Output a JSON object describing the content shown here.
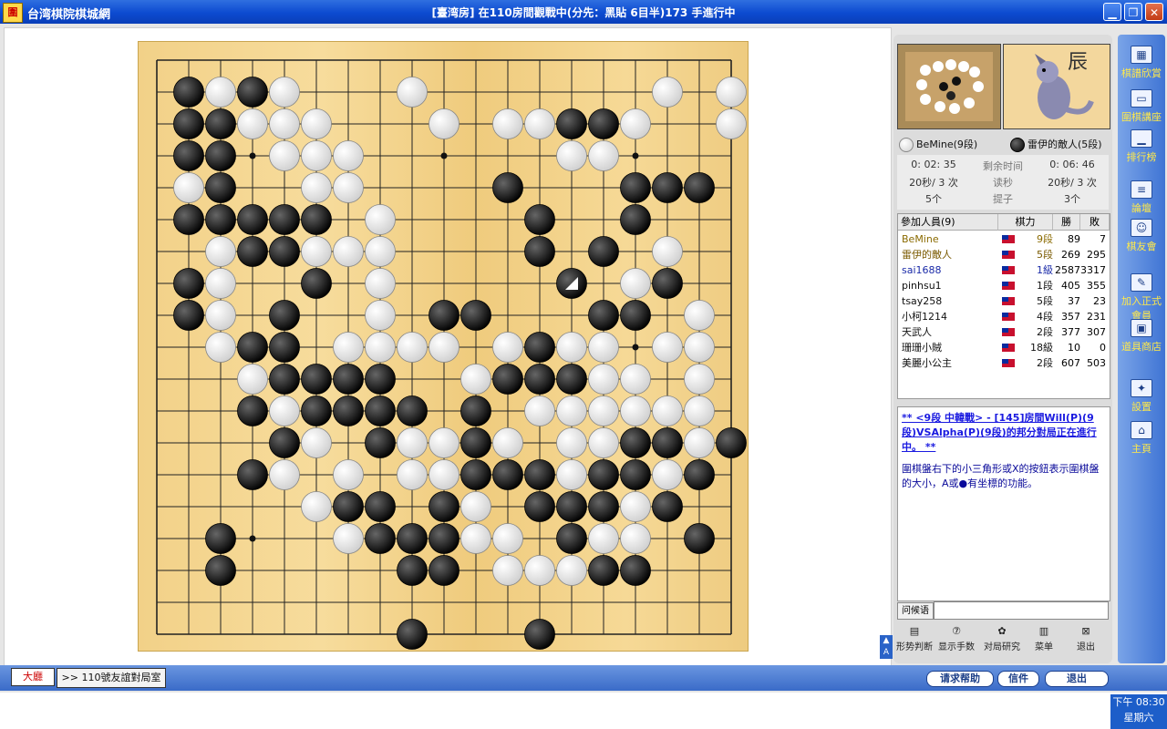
{
  "titlebar": {
    "app_icon": "圍",
    "app_title": "台湾棋院棋城網",
    "room_title": "[臺湾房] 在110房間觀戰中(分先：黑貼 6目半)173 手進行中",
    "minimize_glyph": "▁",
    "maximize_glyph": "❐",
    "close_glyph": "✕"
  },
  "board": {
    "size": 19,
    "white": [
      [
        3,
        2
      ],
      [
        4,
        2
      ],
      [
        5,
        3
      ],
      [
        3,
        3
      ],
      [
        4,
        3
      ],
      [
        5,
        4
      ],
      [
        6,
        4
      ],
      [
        7,
        5
      ],
      [
        9,
        2
      ],
      [
        10,
        3
      ],
      [
        12,
        3
      ],
      [
        13,
        3
      ],
      [
        14,
        4
      ],
      [
        15,
        4
      ],
      [
        16,
        3
      ],
      [
        17,
        2
      ],
      [
        19,
        2
      ],
      [
        19,
        3
      ],
      [
        16,
        5
      ],
      [
        16,
        6
      ],
      [
        17,
        7
      ],
      [
        16,
        8
      ],
      [
        17,
        8
      ],
      [
        18,
        9
      ],
      [
        15,
        10
      ],
      [
        17,
        10
      ],
      [
        18,
        10
      ],
      [
        18,
        11
      ],
      [
        18,
        12
      ],
      [
        18,
        13
      ],
      [
        17,
        14
      ],
      [
        16,
        15
      ],
      [
        16,
        16
      ],
      [
        15,
        16
      ],
      [
        15,
        17
      ],
      [
        13,
        17
      ],
      [
        14,
        17
      ],
      [
        12,
        17
      ],
      [
        10,
        17
      ],
      [
        11,
        16
      ],
      [
        13,
        15
      ],
      [
        12,
        14
      ],
      [
        12,
        13
      ],
      [
        11,
        13
      ],
      [
        11,
        12
      ],
      [
        11,
        11
      ],
      [
        10,
        10
      ],
      [
        9,
        10
      ],
      [
        8,
        10
      ],
      [
        7,
        10
      ],
      [
        8,
        9
      ],
      [
        8,
        8
      ],
      [
        8,
        7
      ],
      [
        8,
        6
      ],
      [
        7,
        7
      ],
      [
        6,
        7
      ],
      [
        6,
        6
      ],
      [
        6,
        5
      ],
      [
        7,
        4
      ],
      [
        6,
        3
      ],
      [
        5,
        2
      ],
      [
        2,
        5
      ],
      [
        2,
        4
      ],
      [
        3,
        7
      ],
      [
        3,
        8
      ],
      [
        3,
        9
      ],
      [
        3,
        10
      ],
      [
        4,
        11
      ],
      [
        5,
        12
      ],
      [
        6,
        13
      ],
      [
        6,
        15
      ],
      [
        5,
        14
      ],
      [
        7,
        14
      ],
      [
        7,
        16
      ],
      [
        10,
        15
      ],
      [
        10,
        14
      ],
      [
        9,
        14
      ],
      [
        9,
        13
      ],
      [
        13,
        12
      ],
      [
        12,
        11
      ],
      [
        12,
        10
      ],
      [
        13,
        10
      ],
      [
        14,
        10
      ],
      [
        14,
        11
      ],
      [
        14,
        12
      ],
      [
        15,
        12
      ],
      [
        16,
        12
      ],
      [
        17,
        12
      ],
      [
        12,
        16
      ],
      [
        11,
        15
      ],
      [
        10,
        13
      ],
      [
        15,
        11
      ],
      [
        16,
        11
      ],
      [
        14,
        13
      ],
      [
        15,
        13
      ],
      [
        14,
        14
      ],
      [
        4,
        14
      ]
    ],
    "black": [
      [
        2,
        3
      ],
      [
        2,
        4
      ],
      [
        3,
        4
      ],
      [
        4,
        6
      ],
      [
        5,
        6
      ],
      [
        5,
        7
      ],
      [
        6,
        8
      ],
      [
        6,
        6
      ],
      [
        4,
        7
      ],
      [
        3,
        6
      ],
      [
        3,
        5
      ],
      [
        3,
        3
      ],
      [
        2,
        2
      ],
      [
        4,
        2
      ],
      [
        2,
        6
      ],
      [
        2,
        8
      ],
      [
        2,
        9
      ],
      [
        4,
        10
      ],
      [
        5,
        9
      ],
      [
        5,
        10
      ],
      [
        5,
        11
      ],
      [
        4,
        12
      ],
      [
        5,
        13
      ],
      [
        4,
        14
      ],
      [
        3,
        16
      ],
      [
        3,
        17
      ],
      [
        6,
        12
      ],
      [
        6,
        11
      ],
      [
        7,
        11
      ],
      [
        7,
        12
      ],
      [
        8,
        12
      ],
      [
        8,
        13
      ],
      [
        7,
        15
      ],
      [
        8,
        15
      ],
      [
        8,
        16
      ],
      [
        9,
        16
      ],
      [
        9,
        17
      ],
      [
        10,
        16
      ],
      [
        10,
        17
      ],
      [
        9,
        19
      ],
      [
        11,
        13
      ],
      [
        11,
        14
      ],
      [
        12,
        14
      ],
      [
        13,
        14
      ],
      [
        13,
        15
      ],
      [
        14,
        15
      ],
      [
        14,
        16
      ],
      [
        15,
        14
      ],
      [
        15,
        15
      ],
      [
        16,
        14
      ],
      [
        16,
        13
      ],
      [
        17,
        13
      ],
      [
        18,
        14
      ],
      [
        18,
        16
      ],
      [
        17,
        15
      ],
      [
        15,
        17
      ],
      [
        16,
        17
      ],
      [
        13,
        19
      ],
      [
        10,
        15
      ],
      [
        11,
        12
      ],
      [
        13,
        10
      ],
      [
        14,
        8
      ],
      [
        15,
        7
      ],
      [
        16,
        6
      ],
      [
        16,
        5
      ],
      [
        17,
        5
      ],
      [
        18,
        5
      ],
      [
        19,
        13
      ],
      [
        15,
        9
      ],
      [
        14,
        11
      ],
      [
        13,
        11
      ],
      [
        12,
        11
      ],
      [
        11,
        9
      ],
      [
        10,
        9
      ],
      [
        9,
        12
      ],
      [
        8,
        11
      ],
      [
        16,
        9
      ],
      [
        17,
        8
      ],
      [
        14,
        3
      ],
      [
        12,
        5
      ],
      [
        13,
        6
      ],
      [
        13,
        7
      ],
      [
        15,
        3
      ]
    ],
    "last_move": [
      14,
      8
    ],
    "hoshi": [
      [
        4,
        4
      ],
      [
        10,
        4
      ],
      [
        16,
        4
      ],
      [
        4,
        10
      ],
      [
        10,
        10
      ],
      [
        16,
        10
      ],
      [
        4,
        16
      ],
      [
        10,
        16
      ],
      [
        16,
        16
      ]
    ]
  },
  "players": {
    "white_name": "BeMine(9段)",
    "black_name": "雷伊的敵人(5段)"
  },
  "clock": {
    "white_time": "0: 02: 35",
    "time_label": "剩余时间",
    "black_time": "0: 06: 46",
    "white_byoyomi": "20秒/ 3 次",
    "byoyomi_label": "读秒",
    "black_byoyomi": "20秒/ 3 次",
    "white_captures": "5个",
    "captures_label": "提子",
    "black_captures": "3个"
  },
  "participants": {
    "header_name": "參加人員(9)",
    "header_rank": "棋力",
    "header_wins": "勝",
    "header_losses": "敗",
    "rows": [
      {
        "name": "BeMine",
        "rank": "9段",
        "wins": "89",
        "losses": "7",
        "color": "#8a6a00"
      },
      {
        "name": "雷伊的敵人",
        "rank": "5段",
        "wins": "269",
        "losses": "295",
        "color": "#7a5a00"
      },
      {
        "name": "sai1688",
        "rank": "1級",
        "wins": "2587",
        "losses": "3317",
        "color": "#1a2aa8"
      },
      {
        "name": "pinhsu1",
        "rank": "1段",
        "wins": "405",
        "losses": "355",
        "color": "#111111"
      },
      {
        "name": "tsay258",
        "rank": "5段",
        "wins": "37",
        "losses": "23",
        "color": "#111111"
      },
      {
        "name": "小柯1214",
        "rank": "4段",
        "wins": "357",
        "losses": "231",
        "color": "#111111"
      },
      {
        "name": "天武人",
        "rank": "2段",
        "wins": "377",
        "losses": "307",
        "color": "#111111"
      },
      {
        "name": "珊珊小賊",
        "rank": "18級",
        "wins": "10",
        "losses": "0",
        "color": "#111111"
      },
      {
        "name": "美麗小公主",
        "rank": "2段",
        "wins": "607",
        "losses": "503",
        "color": "#111111"
      }
    ]
  },
  "news": {
    "headline": "** <9段 中韓戰> - [145]房間Will(P)(9段)VSAlpha(P)(9段)的邦分對局正在進行中。 **",
    "tip": "圍棋盤右下的小三角形或X的按鈕表示圍棋盤的大小，A或●有坐標的功能。"
  },
  "chat": {
    "label": "问候语"
  },
  "tools": [
    {
      "label": "形势判断",
      "icon": "▤"
    },
    {
      "label": "显示手数",
      "icon": "⑦"
    },
    {
      "label": "对局研究",
      "icon": "✿"
    },
    {
      "label": "菜单",
      "icon": "▥"
    },
    {
      "label": "退出",
      "icon": "⊠"
    }
  ],
  "right_bar": [
    {
      "label": "棋譜欣賞",
      "icon": "▦"
    },
    {
      "label": "圍棋講座",
      "icon": "▭"
    },
    {
      "label": "排行榜",
      "icon": "▁"
    },
    {
      "label": "論壇",
      "icon": "≡"
    },
    {
      "label": "棋友會",
      "icon": "☺"
    },
    {
      "label": "加入正式會員",
      "icon": "✎"
    },
    {
      "label": "道具商店",
      "icon": "▣"
    },
    {
      "label": "設置",
      "icon": "✦"
    },
    {
      "label": "主頁",
      "icon": "⌂"
    }
  ],
  "bottom": {
    "tab_lobby": "大廳",
    "tab_room": ">> 110號友誼對局室",
    "help_button": "请求帮助",
    "mail_button": "信件",
    "exit_button": "退出",
    "az_top": "▲",
    "az_bottom": "A"
  },
  "system_clock": {
    "time": "下午 08:30",
    "day": "星期六"
  },
  "colors": {
    "title_blue": "#0c4ad0",
    "board_wood": "#f2d188",
    "accent_yellow": "#ffe94a"
  }
}
